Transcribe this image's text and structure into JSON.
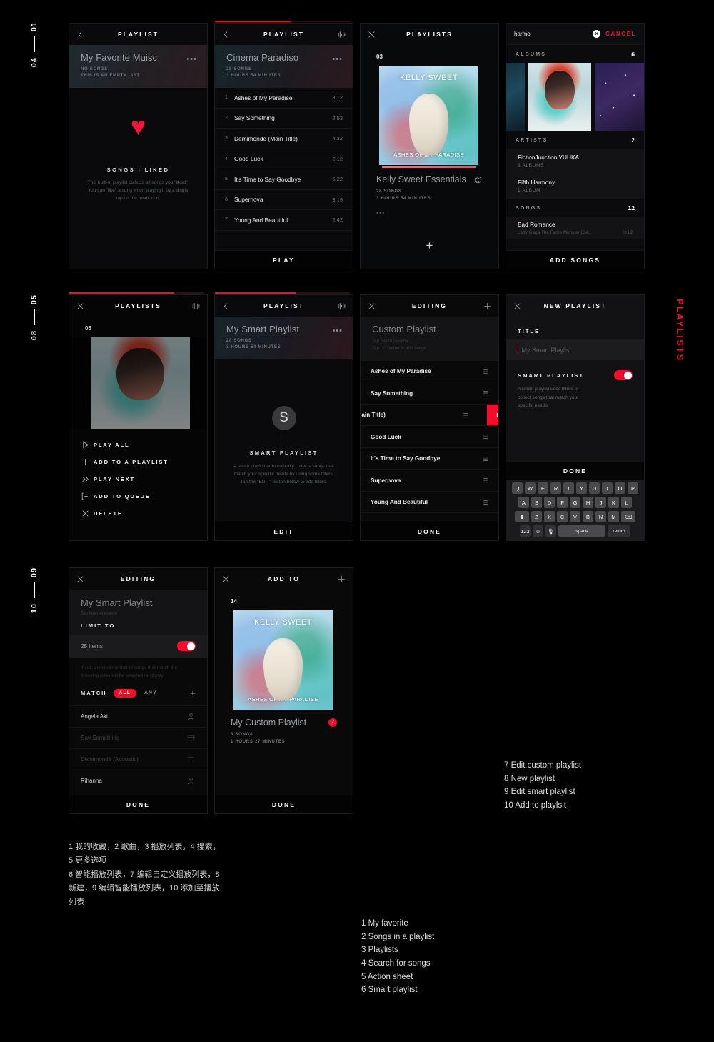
{
  "row_markers": [
    {
      "from": "01",
      "to": "04"
    },
    {
      "from": "05",
      "to": "08"
    },
    {
      "from": "09",
      "to": "10"
    }
  ],
  "side_title": "PLAYLISTS",
  "screens": {
    "s1": {
      "nav_title": "PLAYLIST",
      "back_icon": "chevron-left-icon",
      "playlist_title": "My Favorite Muisc",
      "sub1": "NO SONGS",
      "sub2": "THIS IS AN EMPTY LIST",
      "more_icon": "ellipsis-icon",
      "heart_icon": "heart-icon",
      "empty_title": "SONGS I LIKED",
      "empty_body": "This built-in playlist collects all songs you \"liked\". You can \"like\" a song when playing it by a single tap on the heart icon."
    },
    "s2": {
      "nav_title": "PLAYLIST",
      "back_icon": "chevron-left-icon",
      "eq_icon": "equalizer-icon",
      "progress": 56,
      "playlist_title": "Cinema Paradiso",
      "sub1": "28 SONGS",
      "sub2": "3 HOURS 54 MINUTES",
      "more_icon": "ellipsis-icon",
      "songs": [
        {
          "idx": "1",
          "name": "Ashes of My Paradise",
          "dur": "3:12"
        },
        {
          "idx": "2",
          "name": "Say Something",
          "dur": "2:53"
        },
        {
          "idx": "3",
          "name": "Demimonde (Main Title)",
          "dur": "4:32"
        },
        {
          "idx": "4",
          "name": "Good Luck",
          "dur": "2:12"
        },
        {
          "idx": "5",
          "name": "It's Time to Say Goodbye",
          "dur": "5:22"
        },
        {
          "idx": "6",
          "name": "Supernova",
          "dur": "3:19"
        },
        {
          "idx": "7",
          "name": "Young And Beautiful",
          "dur": "2:42"
        }
      ],
      "play_label": "PLAY"
    },
    "s3": {
      "nav_title": "PLAYLISTS",
      "close_icon": "close-icon",
      "page_number": "03",
      "art_title": "KELLY SWEET",
      "art_foot": "ASHES OF MY PARADISE",
      "playlist_title": "Kelly Sweet Essentials",
      "sub1": "28 SONGS",
      "sub2": "3 HOURS 54 MINUTES",
      "smart_badge_icon": "smart-playlist-icon",
      "more_icon": "ellipsis-icon",
      "add_icon": "plus-icon"
    },
    "s4": {
      "query": "harmo",
      "clear_icon": "clear-circle-icon",
      "cancel_label": "CANCEL",
      "albums_label": "ALBUMS",
      "albums_count": "6",
      "artists_label": "ARTISTS",
      "artists_count": "2",
      "artists": [
        {
          "name": "FictionJunction YUUKA",
          "meta": "3 ALBUMS"
        },
        {
          "name": "Fifth Harmony",
          "meta": "1 ALBUM"
        }
      ],
      "songs_label": "SONGS",
      "songs_count": "12",
      "song": {
        "title": "Bad Romance",
        "artist": "Lady Gaga",
        "album": "The Fame Monster [De...",
        "dur": "3:12"
      },
      "add_songs_label": "ADD SONGS"
    },
    "s5": {
      "nav_title": "PLAYLISTS",
      "close_icon": "close-icon",
      "eq_icon": "equalizer-icon",
      "progress": 78,
      "page_number": "05",
      "actions": [
        {
          "icon": "play-triangle-icon",
          "label": "PLAY ALL"
        },
        {
          "icon": "plus-icon",
          "label": "ADD TO A PLAYLIST"
        },
        {
          "icon": "double-chevron-right-icon",
          "label": "PLAY NEXT"
        },
        {
          "icon": "add-to-queue-icon",
          "label": "ADD TO QUEUE"
        },
        {
          "icon": "close-icon",
          "label": "DELETE"
        }
      ]
    },
    "s6": {
      "nav_title": "PLAYLIST",
      "back_icon": "chevron-left-icon",
      "eq_icon": "equalizer-icon",
      "progress": 60,
      "playlist_title": "My Smart Playlist",
      "sub1": "28 SONGS",
      "sub2": "3 HOURS 54 MINUTES",
      "more_icon": "ellipsis-icon",
      "badge_letter": "S",
      "info_title": "SMART PLAYLIST",
      "info_body": "A smart playlist automatically collects songs that match your specific needs by using some filters. Tap the \"EDIT\" button below to add filters.",
      "edit_label": "EDIT"
    },
    "s7": {
      "nav_title": "EDITING",
      "close_icon": "close-icon",
      "add_icon": "plus-icon",
      "playlist_title": "Custom Playlist",
      "hint1": "Tap title to rename",
      "hint2": "Tap \"+\" button to add songs",
      "rows": [
        {
          "name": "Ashes of My Paradise",
          "swiped": false
        },
        {
          "name": "Say Something",
          "swiped": false
        },
        {
          "name": "de (Main Title)",
          "swiped": true
        },
        {
          "name": "Good Luck",
          "swiped": false
        },
        {
          "name": "It's Time to Say Goodbye",
          "swiped": false
        },
        {
          "name": "Supernova",
          "swiped": false
        },
        {
          "name": "Young And Beautiful",
          "swiped": false
        }
      ],
      "delete_label": "DELETE",
      "done_label": "DONE"
    },
    "s8": {
      "nav_title": "NEW PLAYLIST",
      "close_icon": "close-icon",
      "title_label": "TITLE",
      "title_placeholder": "My Smart Playlist",
      "smart_label": "SMART PLAYLIST",
      "smart_on": true,
      "smart_body": "A smart playlist uses filters to collect songs that match your specific needs.",
      "done_label": "DONE",
      "keyboard": {
        "row1": [
          "Q",
          "W",
          "E",
          "R",
          "T",
          "Y",
          "U",
          "I",
          "O",
          "P"
        ],
        "row2": [
          "A",
          "S",
          "D",
          "F",
          "G",
          "H",
          "J",
          "K",
          "L"
        ],
        "row3": [
          "Z",
          "X",
          "C",
          "V",
          "B",
          "N",
          "M"
        ],
        "shift_icon": "shift-icon",
        "backspace_icon": "backspace-icon",
        "numbers_key": "123",
        "emoji_icon": "emoji-icon",
        "mic_icon": "microphone-icon",
        "space_key": "space",
        "return_key": "return"
      }
    },
    "s9": {
      "nav_title": "EDITING",
      "close_icon": "close-icon",
      "playlist_title": "My Smart Playlist",
      "hint": "Tap title to rename",
      "limit_label": "LIMIT TO",
      "limit_value": "25 items",
      "limit_on": true,
      "limit_body": "If set, a limited number of songs that match the following rules will be selected randomly.",
      "match_label": "MATCH",
      "match_all": "ALL",
      "match_any": "ANY",
      "add_icon": "plus-icon",
      "rules": [
        {
          "text": "Angela Aki",
          "icon": "person-icon",
          "dim": false
        },
        {
          "text": "Say Something",
          "icon": "album-icon",
          "dim": true
        },
        {
          "text": "Demimonde (Acoustic)",
          "icon": "title-icon",
          "dim": true
        },
        {
          "text": "Rihanna",
          "icon": "person-icon",
          "dim": false
        }
      ],
      "done_label": "DONE"
    },
    "s10": {
      "nav_title": "ADD TO",
      "close_icon": "close-icon",
      "add_icon": "plus-icon",
      "page_number": "14",
      "art_title": "KELLY SWEET",
      "art_foot": "ASHES OF MY PARADISE",
      "playlist_title": "My Custom Playlist",
      "sub1": "8 SONGS",
      "sub2": "1 HOURS 27 MINUTES",
      "check_icon": "check-circle-icon",
      "done_label": "DONE"
    }
  },
  "captions": {
    "right_list": [
      "7 Edit custom playlist",
      "8 New playlist",
      "9 Edit smart playlist",
      "10 Add to playlsit"
    ],
    "chinese": "1 我的收藏，2 歌曲，3 播放列表，4 搜索，5 更多选项\n6 智能播放列表，7 编辑自定义播放列表，8 新建，9 编辑智能播放列表，10 添加至播放列表",
    "center_list": [
      "1 My favorite",
      "2 Songs in a playlist",
      "3 Playlists",
      "4 Search for songs",
      "5 Action sheet",
      "6 Smart playlist"
    ]
  }
}
